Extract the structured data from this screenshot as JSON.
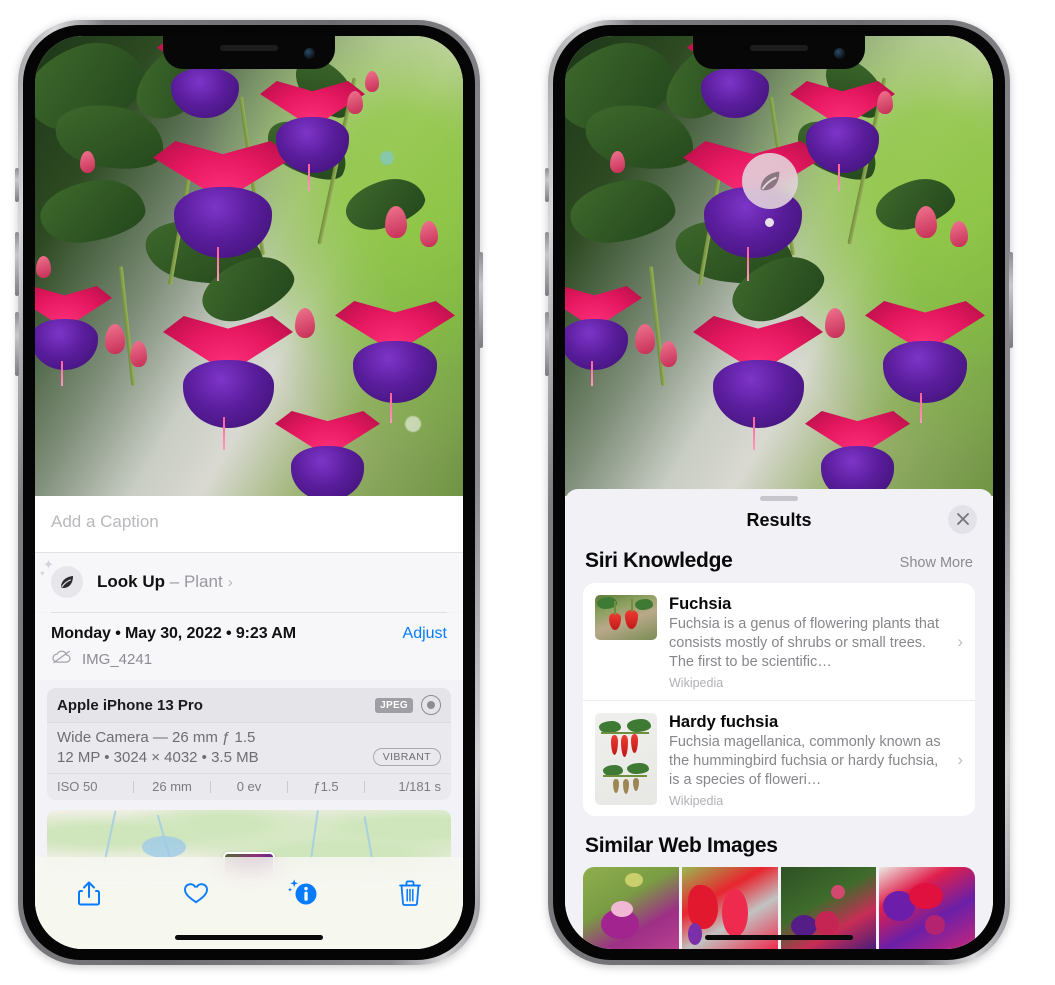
{
  "left_phone": {
    "caption": {
      "placeholder": "Add a Caption",
      "value": ""
    },
    "lookup": {
      "icon": "leaf-icon",
      "label": "Look Up",
      "dash": "–",
      "subject": "Plant",
      "chevron": "›"
    },
    "metadata": {
      "date": "Monday • May 30, 2022 • 9:23 AM",
      "adjust_label": "Adjust",
      "cloud_icon": "cloud-slash-icon",
      "filename": "IMG_4241"
    },
    "camera_card": {
      "device": "Apple iPhone 13 Pro",
      "format_badge": "JPEG",
      "raw_icon": "raw-circle-icon",
      "lens": "Wide Camera — 26 mm ƒ 1.5",
      "specs": "12 MP • 3024 × 4032 • 3.5 MB",
      "style_badge": "VIBRANT",
      "exif": [
        "ISO 50",
        "26 mm",
        "0 ev",
        "ƒ1.5",
        "1/181 s"
      ]
    },
    "toolbar": [
      {
        "name": "share-button",
        "icon": "share-icon"
      },
      {
        "name": "favorite-button",
        "icon": "heart-icon"
      },
      {
        "name": "info-button",
        "icon": "info-sparkle-icon"
      },
      {
        "name": "delete-button",
        "icon": "trash-icon"
      }
    ],
    "accent_color": "#067bfb"
  },
  "right_phone": {
    "visual_lookup_badge": {
      "icon": "leaf-icon"
    },
    "sheet": {
      "title": "Results",
      "close_icon": "close-icon"
    },
    "siri_knowledge": {
      "heading": "Siri Knowledge",
      "show_more": "Show More",
      "items": [
        {
          "title": "Fuchsia",
          "description": "Fuchsia is a genus of flowering plants that consists mostly of shrubs or small trees. The first to be scientific…",
          "source": "Wikipedia",
          "chevron": "›"
        },
        {
          "title": "Hardy fuchsia",
          "description": "Fuchsia magellanica, commonly known as the hummingbird fuchsia or hardy fuchsia, is a species of floweri…",
          "source": "Wikipedia",
          "chevron": "›"
        }
      ]
    },
    "similar_web_images": {
      "heading": "Similar Web Images",
      "images": [
        {
          "alt": "fuchsia-thumb-1"
        },
        {
          "alt": "fuchsia-thumb-2"
        },
        {
          "alt": "fuchsia-thumb-3"
        },
        {
          "alt": "fuchsia-thumb-4"
        }
      ]
    }
  }
}
